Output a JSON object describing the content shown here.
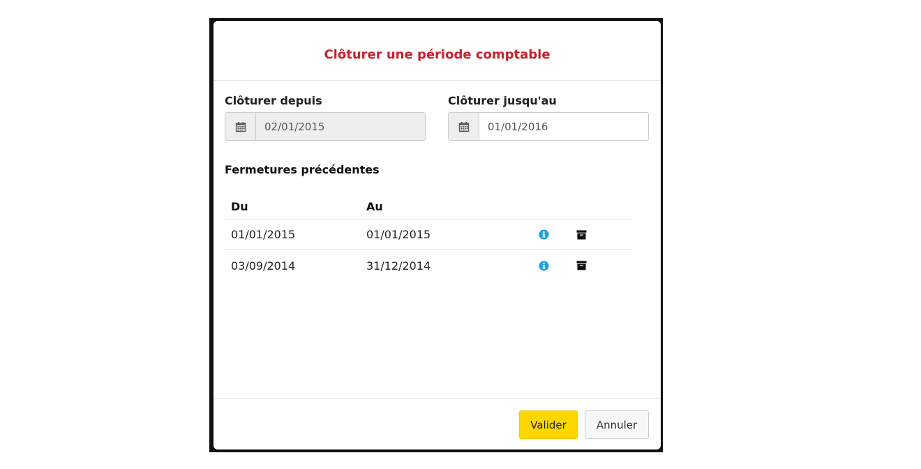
{
  "modal": {
    "title": "Clôturer une période comptable"
  },
  "fields": {
    "from": {
      "label": "Clôturer depuis",
      "value": "02/01/2015",
      "icon": "calendar-icon",
      "disabled": true
    },
    "to": {
      "label": "Clôturer jusqu'au",
      "value": "01/01/2016",
      "icon": "calendar-icon",
      "disabled": false
    }
  },
  "previous": {
    "title": "Fermetures précédentes",
    "headers": {
      "du": "Du",
      "au": "Au"
    },
    "rows": [
      {
        "du": "01/01/2015",
        "au": "01/01/2015"
      },
      {
        "du": "03/09/2014",
        "au": "31/12/2014"
      }
    ],
    "icons": {
      "info": "info-icon",
      "archive": "archive-icon"
    }
  },
  "footer": {
    "validate_label": "Valider",
    "cancel_label": "Annuler"
  },
  "colors": {
    "title": "#c9202a",
    "primary_button": "#ffd600",
    "info_icon": "#1ba1e2"
  }
}
